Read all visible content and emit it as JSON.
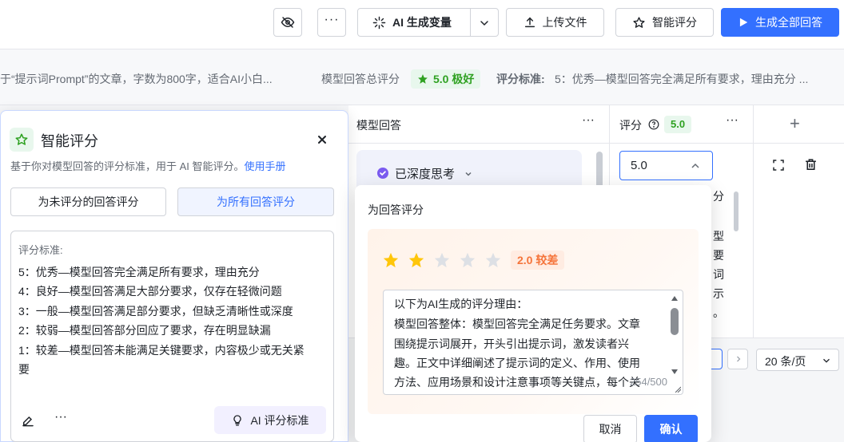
{
  "toolbar": {
    "ai_variable_label": "AI 生成变量",
    "upload_label": "上传文件",
    "smart_score_label": "智能评分",
    "generate_all_label": "生成全部回答"
  },
  "summary": {
    "prompt_text": "于“提示词Prompt”的文章，字数为800字，适合AI小白...",
    "total_label": "模型回答总评分",
    "total_badge": "5.0 极好",
    "criteria_label": "评分标准:",
    "criteria_text": "5：优秀—模型回答完全满足所有要求，理由充分 ..."
  },
  "table": {
    "col_answer": "模型回答",
    "col_score": "评分",
    "score_badge": "5.0",
    "deep_think": "已深度思考",
    "score_value": "5.0",
    "partial_chars": [
      "分",
      "型",
      "要",
      "词",
      "示",
      "。"
    ],
    "page_size": "20 条/页"
  },
  "panel": {
    "title": "智能评分",
    "desc": "基于你对模型回答的评分标准，用于 AI 智能评分。",
    "manual_link": "使用手册",
    "btn_unscored": "为未评分的回答评分",
    "btn_all": "为所有回答评分",
    "criteria_title": "评分标准:",
    "criteria": [
      "5：优秀—模型回答完全满足所有要求，理由充分",
      "4：良好—模型回答满足大部分要求，仅存在轻微问题",
      "3：一般—模型回答满足部分要求，但缺乏清晰性或深度",
      "2：较弱—模型回答部分回应了要求，存在明显缺漏",
      "1：较差—模型回答未能满足关键要求，内容极少或无关紧",
      "要"
    ],
    "ai_criteria_btn": "AI 评分标准"
  },
  "popover": {
    "title": "为回答评分",
    "rating": 2,
    "rating_badge": "2.0 较差",
    "reason_lines": [
      "以下为AI生成的评分理由：",
      "模型回答整体：模型回答完全满足任务要求。文章",
      "围绕提示词展开，开头引出提示词，激发读者兴",
      "趣。正文中详细阐述了提示词的定义、作用、使用",
      "方法、应用场景和设计注意事项等关键点，每个关"
    ],
    "char_count": "254/500",
    "cancel": "取消",
    "confirm": "确认"
  },
  "colors": {
    "primary": "#3370ff",
    "green": "#2ea121",
    "star": "#ffc60a",
    "orange": "#f5743a"
  }
}
